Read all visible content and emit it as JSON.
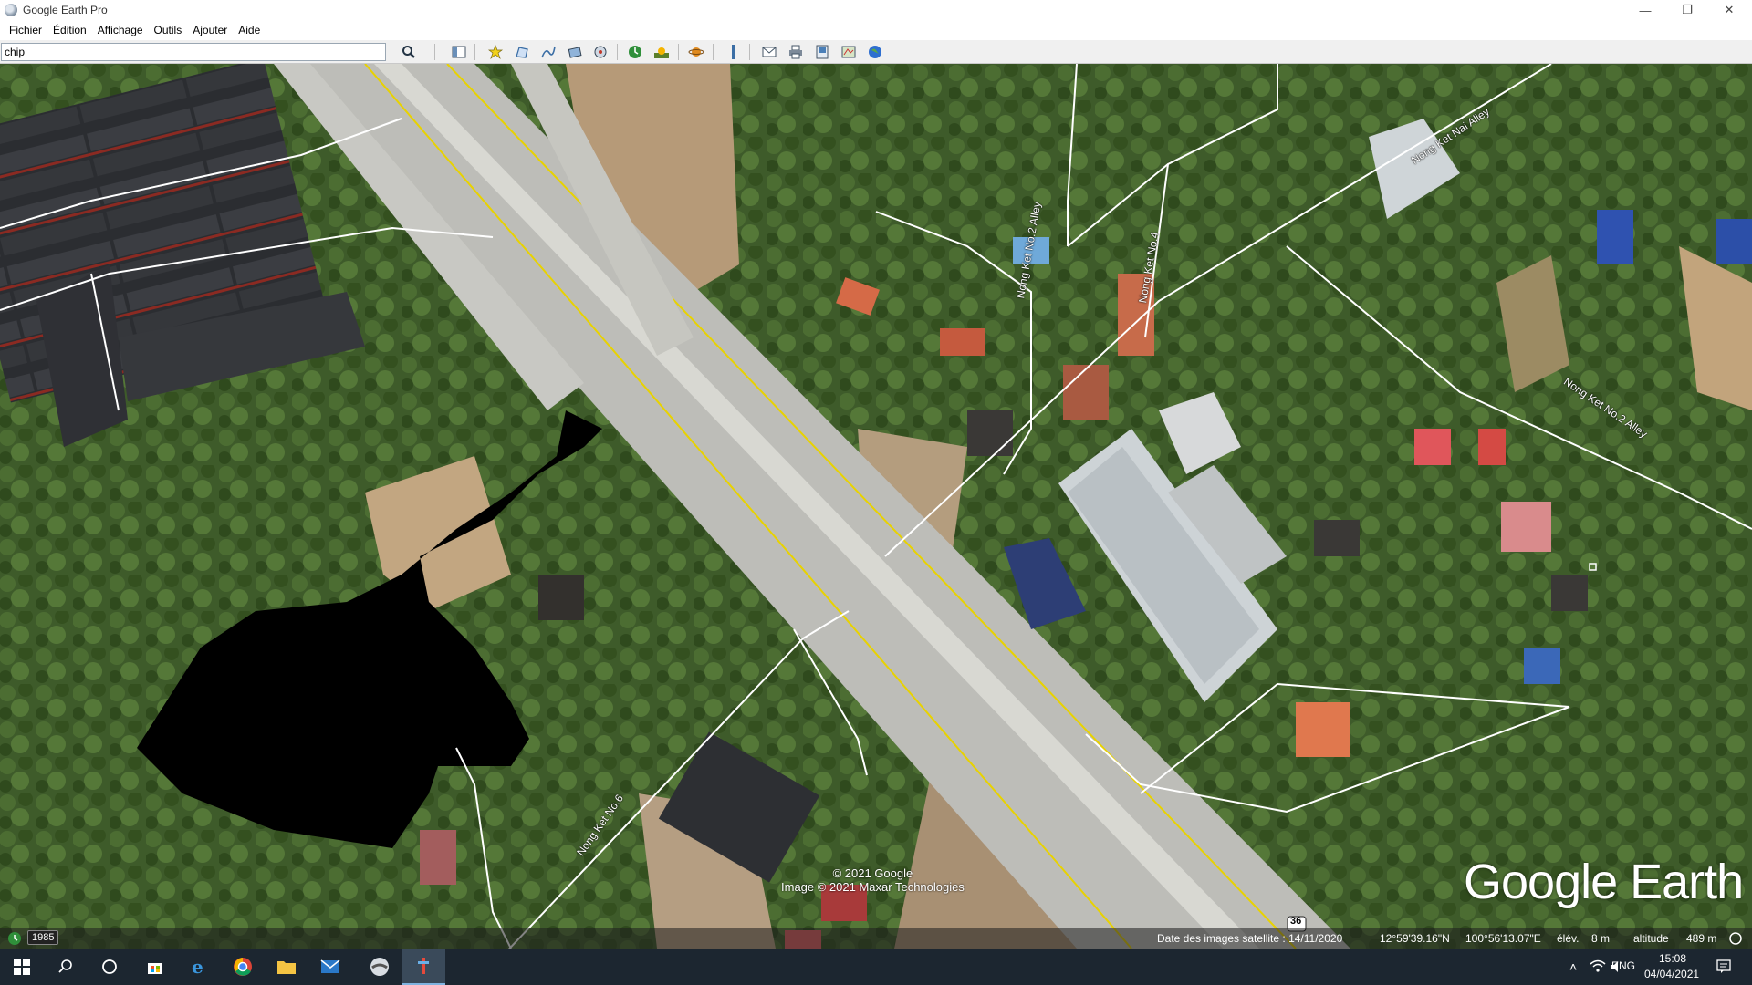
{
  "window": {
    "title": "Google Earth Pro",
    "minimize": "—",
    "maximize": "❐",
    "close": "✕"
  },
  "menu": [
    "Fichier",
    "Édition",
    "Affichage",
    "Outils",
    "Ajouter",
    "Aide"
  ],
  "search": {
    "value": "chip"
  },
  "toolbar_icons": [
    "search-icon",
    "sidebar-toggle-icon",
    "add-placemark-icon",
    "add-polygon-icon",
    "add-path-icon",
    "add-overlay-icon",
    "record-tour-icon",
    "historical-imagery-icon",
    "sunlight-icon",
    "switch-planet-icon",
    "ruler-icon",
    "email-icon",
    "print-icon",
    "save-image-icon",
    "view-in-maps-icon",
    "earth-icon"
  ],
  "map": {
    "road_labels": [
      "Nong Ket No.6",
      "Nong Ket No.2 Alley",
      "Nong Ket No.4",
      "Nong Ket No.2 Alley",
      "Nong Ket Nai Alley"
    ],
    "route_badge": "36",
    "copyright": [
      "© 2021 Google",
      "Image © 2021 Maxar Technologies"
    ],
    "logo": "Google Earth"
  },
  "status": {
    "year": "1985",
    "imagery_date": "Date des images satellite : 14/11/2020",
    "lat": "12°59'39.16\"N",
    "lon": "100°56'13.07\"E",
    "elev_label": "élév.",
    "elev_value": "8 m",
    "alt_label": "altitude",
    "alt_value": "489 m"
  },
  "taskbar": {
    "apps": [
      "windows-start-icon",
      "search-icon",
      "cortana-icon",
      "store-icon",
      "edge-icon",
      "chrome-icon",
      "file-explorer-icon",
      "mail-icon",
      "google-earth-icon",
      "app-icon"
    ],
    "active_app": "app-icon",
    "lang": "ENG",
    "time": "15:08",
    "date": "04/04/2021"
  },
  "colors": {
    "road_yellow": "#e8d200",
    "road_white": "#ffffff",
    "taskbar": "#1c2630",
    "toolbar_bg": "#f0f0f0"
  }
}
